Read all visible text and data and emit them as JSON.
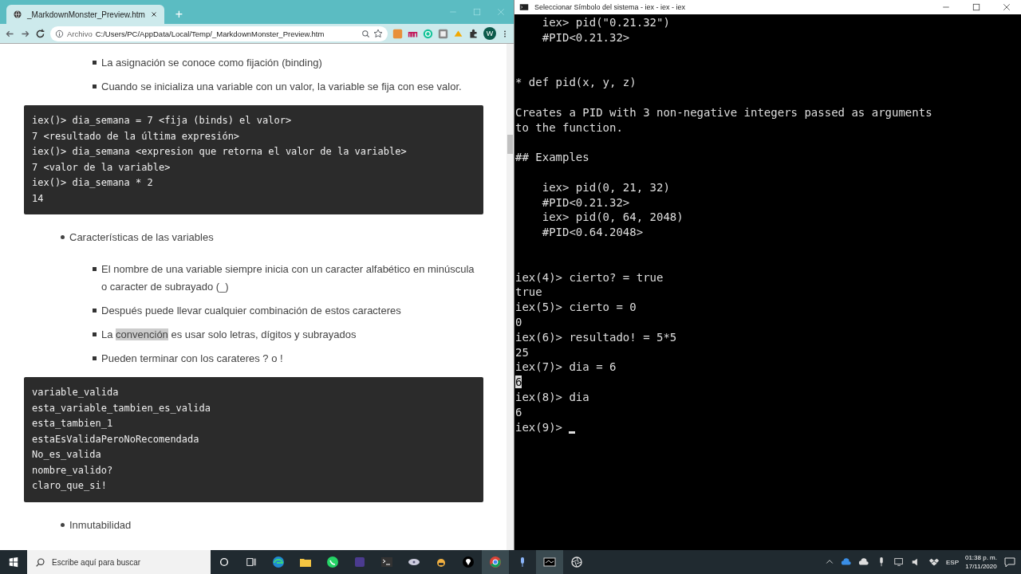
{
  "browser": {
    "tab_title": "_MarkdownMonster_Preview.htm",
    "new_tab": "+",
    "url_label": "Archivo",
    "url": "C:/Users/PC/AppData/Local/Temp/_MarkdownMonster_Preview.htm",
    "profile_initial": "W",
    "content": [
      {
        "kind": "sublist",
        "items": [
          {
            "segments": [
              {
                "text": "La asignación se conoce como fijación (binding)",
                "highlighted": false
              }
            ]
          },
          {
            "segments": [
              {
                "text": "Cuando se inicializa una variable con un valor, la variable se fija con ese valor.",
                "highlighted": false
              }
            ]
          }
        ]
      },
      {
        "kind": "code",
        "lines": [
          "iex()> dia_semana = 7 <fija (binds) el valor>",
          "7 <resultado de la última expresión>",
          "iex()> dia_semana <expresion que retorna el valor de la variable>",
          "7 <valor de la variable>",
          "iex()> dia_semana * 2",
          "14"
        ]
      },
      {
        "kind": "bullet",
        "text": "Características de las variables"
      },
      {
        "kind": "sublist",
        "items": [
          {
            "segments": [
              {
                "text": "El nombre de una variable siempre inicia con un caracter alfabético en minúscula o caracter de subrayado (_)",
                "highlighted": false
              }
            ]
          },
          {
            "segments": [
              {
                "text": "Después puede llevar cualquier combinación de estos caracteres",
                "highlighted": false
              }
            ]
          },
          {
            "segments": [
              {
                "text": "La ",
                "highlighted": false
              },
              {
                "text": "convención",
                "highlighted": true
              },
              {
                "text": " es usar solo letras, dígitos y subrayados",
                "highlighted": false
              }
            ]
          },
          {
            "segments": [
              {
                "text": "Pueden terminar con los carateres ? o !",
                "highlighted": false
              }
            ]
          }
        ]
      },
      {
        "kind": "code",
        "lines": [
          "variable_valida",
          "esta_variable_tambien_es_valida",
          "esta_tambien_1",
          "estaEsValidaPeroNoRecomendada",
          "No_es_valida",
          "nombre_valido?",
          "claro_que_si!"
        ]
      },
      {
        "kind": "bullet",
        "text": "Inmutabilidad"
      }
    ]
  },
  "terminal": {
    "title": "Seleccionar Símbolo del sistema - iex - iex - iex",
    "lines": [
      {
        "kind": "text",
        "text": "    iex> pid(\"0.21.32\")",
        "selected": false
      },
      {
        "kind": "text",
        "text": "    #PID<0.21.32>",
        "selected": false
      },
      {
        "kind": "blank"
      },
      {
        "kind": "blank"
      },
      {
        "kind": "text",
        "text": "* def pid(x, y, z)",
        "selected": false
      },
      {
        "kind": "blank"
      },
      {
        "kind": "text",
        "text": "Creates a PID with 3 non-negative integers passed as arguments",
        "selected": false
      },
      {
        "kind": "text",
        "text": "to the function.",
        "selected": false
      },
      {
        "kind": "blank"
      },
      {
        "kind": "text",
        "text": "## Examples",
        "selected": false
      },
      {
        "kind": "blank"
      },
      {
        "kind": "text",
        "text": "    iex> pid(0, 21, 32)",
        "selected": false
      },
      {
        "kind": "text",
        "text": "    #PID<0.21.32>",
        "selected": false
      },
      {
        "kind": "text",
        "text": "    iex> pid(0, 64, 2048)",
        "selected": false
      },
      {
        "kind": "text",
        "text": "    #PID<0.64.2048>",
        "selected": false
      },
      {
        "kind": "blank"
      },
      {
        "kind": "blank"
      },
      {
        "kind": "text",
        "text": "iex(4)> cierto? = true",
        "selected": false
      },
      {
        "kind": "text",
        "text": "true",
        "selected": false
      },
      {
        "kind": "text",
        "text": "iex(5)> cierto = 0",
        "selected": false
      },
      {
        "kind": "text",
        "text": "0",
        "selected": false
      },
      {
        "kind": "text",
        "text": "iex(6)> resultado! = 5*5",
        "selected": false
      },
      {
        "kind": "text",
        "text": "25",
        "selected": false
      },
      {
        "kind": "text",
        "text": "iex(7)> dia = 6",
        "selected": false
      },
      {
        "kind": "text",
        "text": "6",
        "selected": true
      },
      {
        "kind": "text",
        "text": "iex(8)> dia",
        "selected": false
      },
      {
        "kind": "text",
        "text": "6",
        "selected": false
      },
      {
        "kind": "prompt",
        "text": "iex(9)>",
        "selected": false
      }
    ]
  },
  "taskbar": {
    "search_placeholder": "Escribe aquí para buscar",
    "language": "ESP",
    "time": "01:38 p. m.",
    "date": "17/11/2020"
  }
}
